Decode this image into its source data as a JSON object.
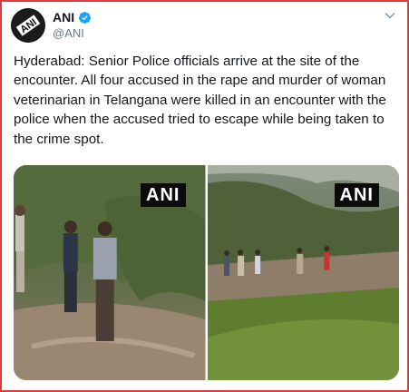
{
  "tweet": {
    "display_name": "ANI",
    "handle": "@ANI",
    "verified": true,
    "avatar_logo_text": "ANI",
    "text": "Hyderabad: Senior Police officials arrive at the site of the encounter. All four accused in the rape and murder of woman veterinarian in Telangana were killed in an encounter with the police when the accused tried to escape while being taken to the crime spot."
  },
  "media": {
    "photos": [
      {
        "watermark": "ANI"
      },
      {
        "watermark": "ANI"
      }
    ]
  },
  "icons": {
    "avatar": "ani-logo-icon",
    "verified": "verified-badge-icon",
    "menu": "chevron-down-icon"
  },
  "colors": {
    "frame_border": "#e0393e",
    "verified_badge": "#1da1f2",
    "handle": "#657786"
  }
}
